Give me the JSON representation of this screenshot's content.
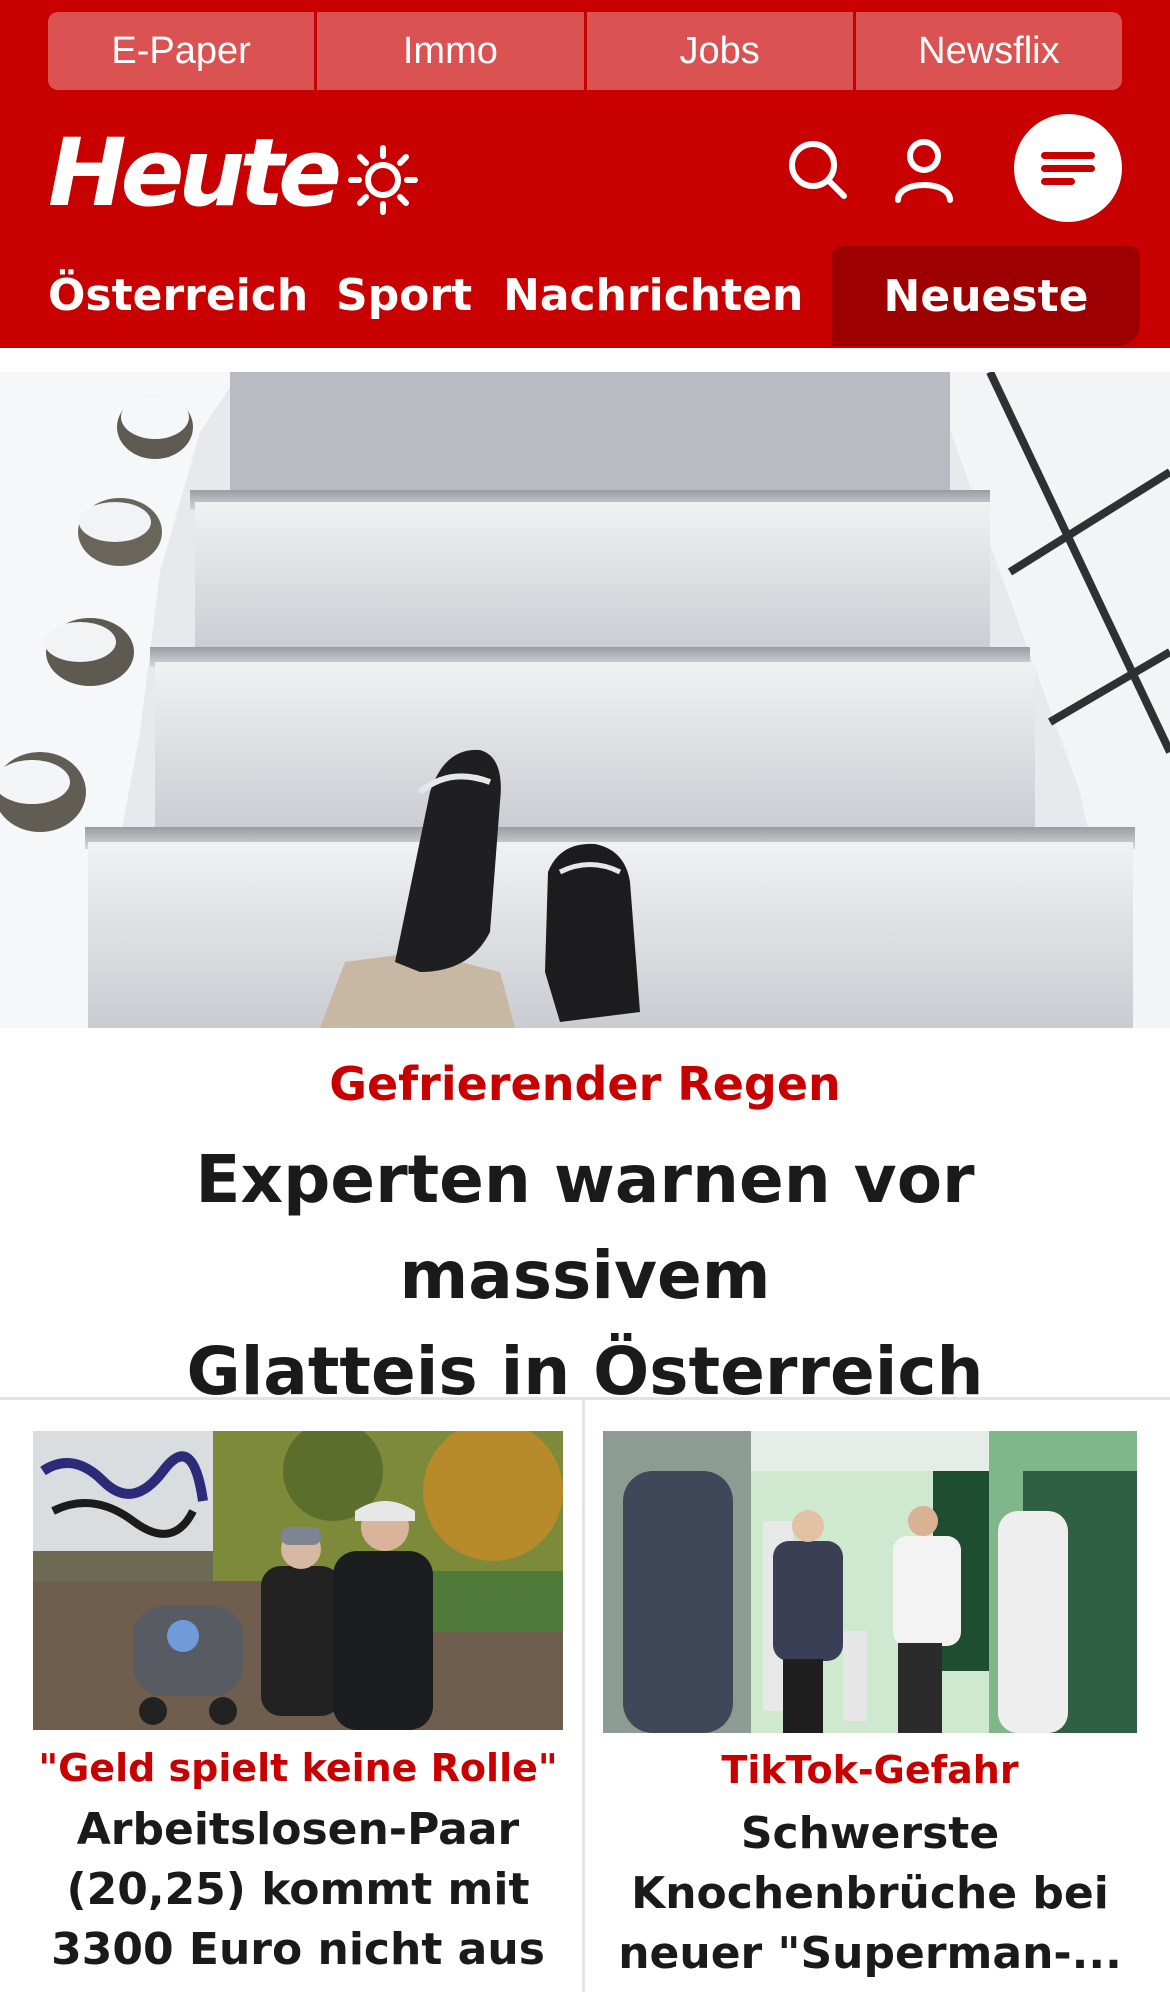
{
  "topnav": [
    "E-Paper",
    "Immo",
    "Jobs",
    "Newsflix"
  ],
  "brand": "Heute",
  "icons": {
    "weather": "sun-icon",
    "search": "search-icon",
    "account": "user-icon",
    "menu": "menu-icon"
  },
  "sections": {
    "austria": "Österreich",
    "sport": "Sport",
    "news": "Nachrichten",
    "latest": "Neueste"
  },
  "hero": {
    "kicker": "Gefrierender Regen",
    "headline_line1": "Experten warnen vor massivem",
    "headline_line2": "Glatteis in Österreich"
  },
  "card_left": {
    "kicker": "\"Geld spielt keine Rolle\"",
    "line1": "Arbeitslosen-Paar",
    "line2": "(20,25) kommt mit",
    "line3": "3300 Euro nicht aus"
  },
  "card_right": {
    "kicker": "TikTok-Gefahr",
    "line1": "Schwerste",
    "line2": "Knochenbrüche bei",
    "line3": "neuer \"Superman-..."
  },
  "colors": {
    "brand_red": "#c80000",
    "tab_red": "#db5252",
    "active_tab": "#9d0000",
    "text": "#1a1a1a"
  }
}
